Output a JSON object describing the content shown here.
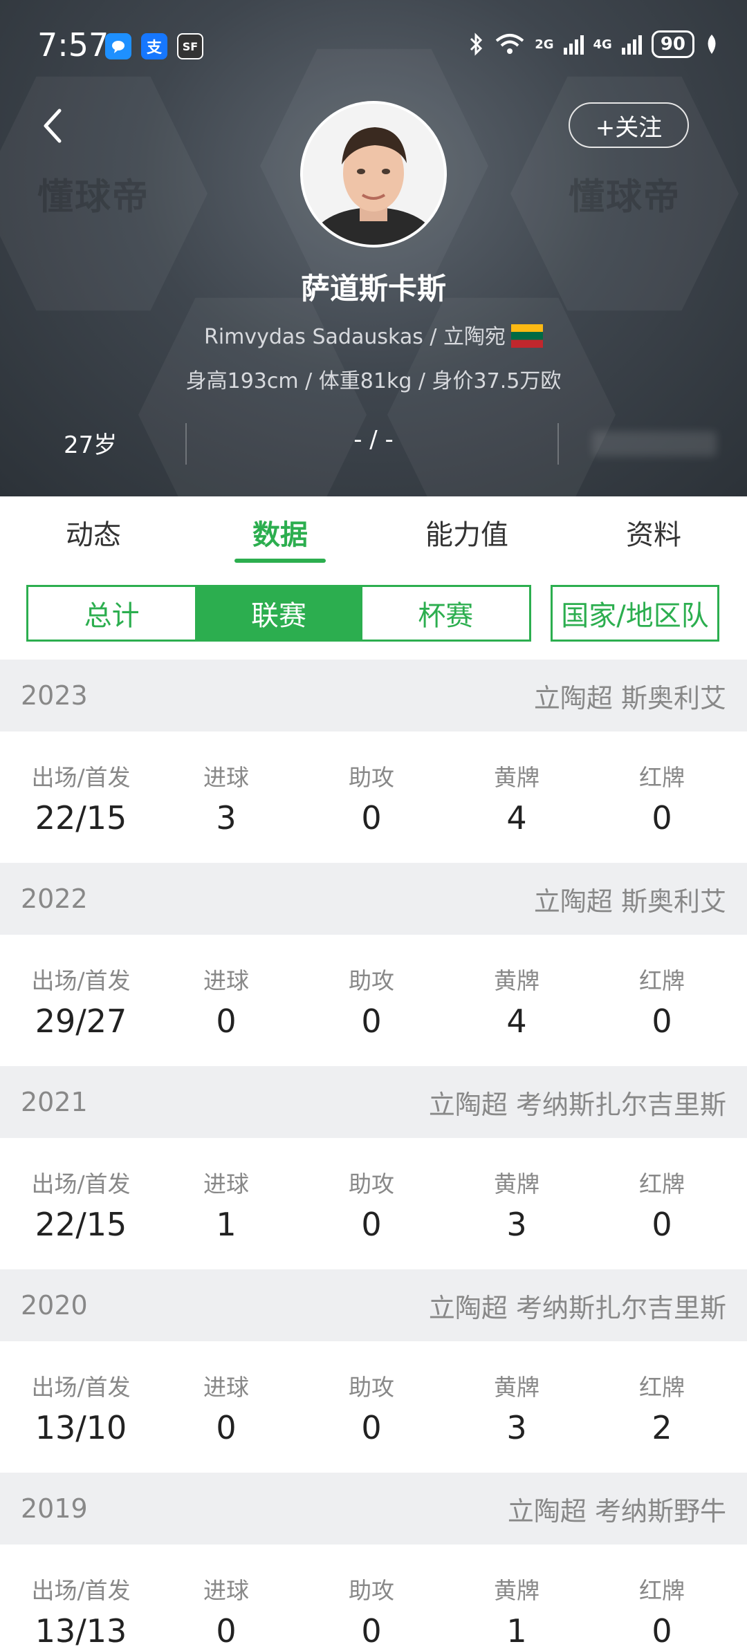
{
  "status_bar": {
    "time": "7:57",
    "net1": "2G",
    "net2": "4G",
    "battery": "90",
    "notif_alipay": "支",
    "notif_sf": "SF"
  },
  "header": {
    "follow_label": "+关注",
    "watermark": "懂球帝",
    "player_name": "萨道斯卡斯",
    "subtitle": "Rimvydas Sadauskas / 立陶宛",
    "info": "身高193cm / 体重81kg / 身价37.5万欧",
    "age": "27岁",
    "middle": "- / -"
  },
  "tabs": [
    {
      "label": "动态"
    },
    {
      "label": "数据",
      "active": true
    },
    {
      "label": "能力值"
    },
    {
      "label": "资料"
    }
  ],
  "segments": [
    {
      "label": "总计"
    },
    {
      "label": "联赛",
      "active": true
    },
    {
      "label": "杯赛"
    }
  ],
  "national_label": "国家/地区队",
  "stat_labels": [
    "出场/首发",
    "进球",
    "助攻",
    "黄牌",
    "红牌"
  ],
  "seasons": [
    {
      "year": "2023",
      "league": "立陶超 斯奥利艾",
      "stats": [
        "22/15",
        "3",
        "0",
        "4",
        "0"
      ]
    },
    {
      "year": "2022",
      "league": "立陶超 斯奥利艾",
      "stats": [
        "29/27",
        "0",
        "0",
        "4",
        "0"
      ]
    },
    {
      "year": "2021",
      "league": "立陶超 考纳斯扎尔吉里斯",
      "stats": [
        "22/15",
        "1",
        "0",
        "3",
        "0"
      ]
    },
    {
      "year": "2020",
      "league": "立陶超 考纳斯扎尔吉里斯",
      "stats": [
        "13/10",
        "0",
        "0",
        "3",
        "2"
      ]
    },
    {
      "year": "2019",
      "league": "立陶超 考纳斯野牛",
      "stats": [
        "13/13",
        "0",
        "0",
        "1",
        "0"
      ]
    }
  ],
  "colors": {
    "accent": "#2cae4f",
    "header_bg": "#3f464e",
    "season_header_bg": "#eeeff1"
  }
}
